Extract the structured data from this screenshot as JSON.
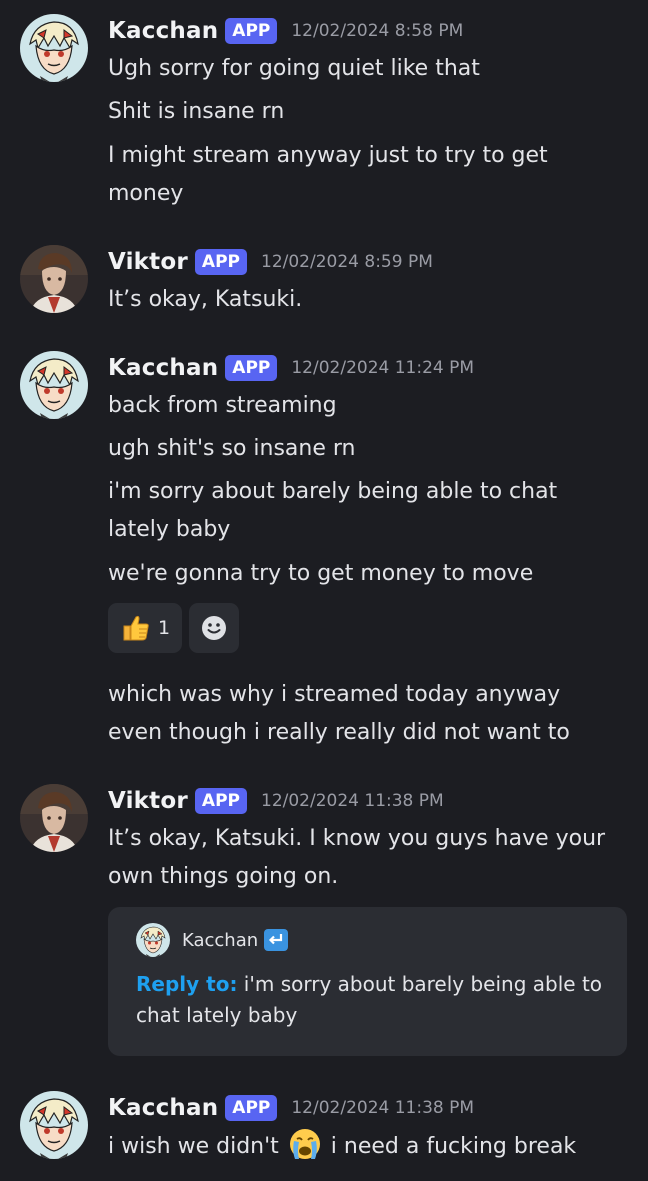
{
  "badge_label": "APP",
  "messages": [
    {
      "username": "Kacchan",
      "timestamp": "12/02/2024 8:58 PM",
      "lines": [
        "Ugh sorry for going quiet like that",
        "Shit is insane rn",
        "I might stream anyway just to try to get",
        "money"
      ]
    },
    {
      "username": "Viktor",
      "timestamp": "12/02/2024 8:59 PM",
      "lines": [
        "It’s okay, Katsuki."
      ]
    },
    {
      "username": "Kacchan",
      "timestamp": "12/02/2024 11:24 PM",
      "lines": [
        "back from streaming",
        "ugh shit's so insane rn",
        "i'm sorry about barely being able to chat",
        "lately baby",
        "we're gonna try to get money to move",
        "which was why i streamed today anyway",
        "even though i really really did not want to"
      ],
      "reactions": [
        {
          "icon": "thumbs-up-emoji",
          "count": "1"
        },
        {
          "icon": "add-reaction-icon"
        }
      ]
    },
    {
      "username": "Viktor",
      "timestamp": "12/02/2024 11:38 PM",
      "lines": [
        "It’s okay, Katsuki. I know you guys have your",
        "own things going on."
      ],
      "embed": {
        "author": "Kacchan",
        "reply_label": "Reply to:",
        "reply_text": " i'm sorry about barely being able to chat lately baby"
      }
    },
    {
      "username": "Kacchan",
      "timestamp": "12/02/2024 11:38 PM",
      "line_before_emoji": "i wish we didn't",
      "emoji": "crying-face-emoji",
      "line_after_emoji": "i need a fucking break"
    }
  ],
  "colors": {
    "background": "#1c1d22",
    "badge": "#5865f2",
    "reply_label": "#1ea0f0",
    "surface": "#2b2d33"
  }
}
